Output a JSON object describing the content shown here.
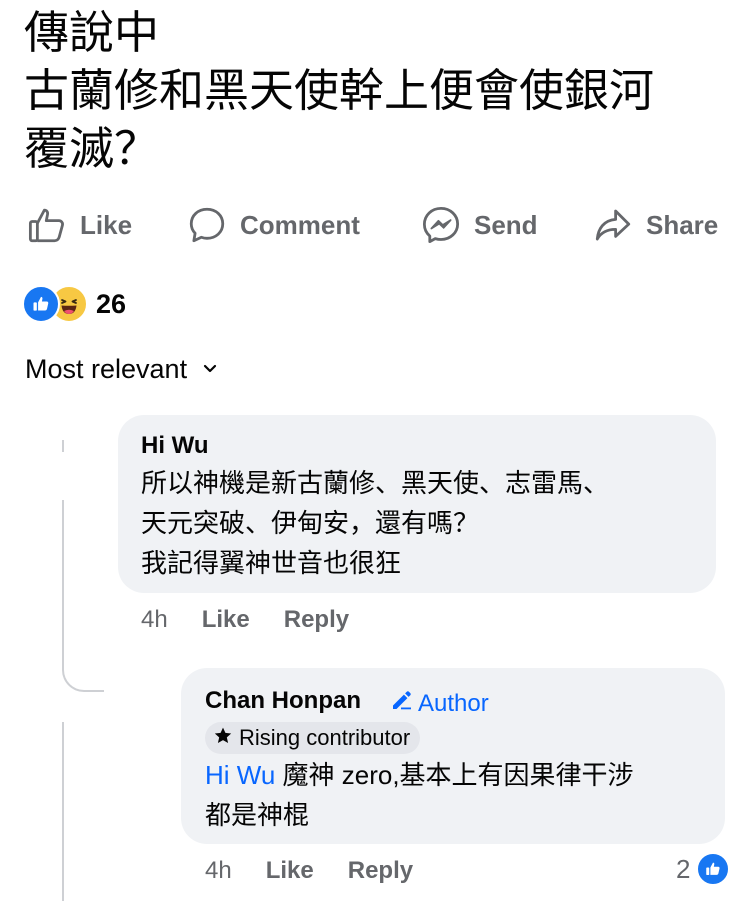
{
  "post": {
    "lines": [
      "傳說中",
      "古蘭修和黑天使幹上便會使銀河",
      "覆滅？"
    ]
  },
  "actions": {
    "like": "Like",
    "comment": "Comment",
    "send": "Send",
    "share": "Share"
  },
  "reactions": {
    "count": "26"
  },
  "sort": {
    "label": "Most relevant"
  },
  "comments": [
    {
      "author": "Hi Wu",
      "lines": [
        "所以神機是新古蘭修、黑天使、志雷馬、",
        "天元突破、伊甸安，還有嗎？",
        "我記得翼神世音也很狂"
      ],
      "time": "4h",
      "like": "Like",
      "reply": "Reply"
    },
    {
      "author": "Chan Honpan",
      "author_badge": "Author",
      "rising": "Rising contributor",
      "mention": "Hi Wu",
      "line1": " 魔神 zero,基本上有因果律干涉",
      "line2": "都是神棍",
      "time": "4h",
      "like": "Like",
      "reply": "Reply",
      "reaction_count": "2"
    }
  ],
  "colors": {
    "accent": "#0866ff",
    "like_blue": "#1877f2",
    "secondary": "#65676b",
    "bubble": "#f0f2f5"
  }
}
